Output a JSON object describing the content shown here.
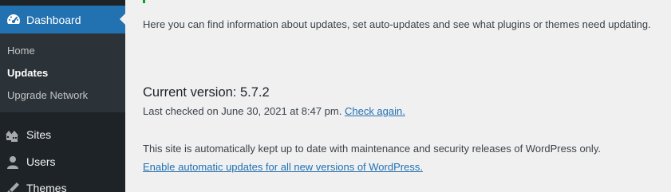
{
  "sidebar": {
    "dashboard": {
      "label": "Dashboard",
      "icon": "dashboard-gauge-icon"
    },
    "submenu": [
      {
        "label": "Home"
      },
      {
        "label": "Updates"
      },
      {
        "label": "Upgrade Network"
      }
    ],
    "items": [
      {
        "label": "Sites",
        "icon": "sites-icon"
      },
      {
        "label": "Users",
        "icon": "users-icon"
      },
      {
        "label": "Themes",
        "icon": "themes-brush-icon"
      }
    ]
  },
  "main": {
    "intro": "Here you can find information about updates, set auto-updates and see what plugins or themes need updating.",
    "current_version": "Current version: 5.7.2",
    "last_checked": "Last checked on June 30, 2021 at 8:47 pm.",
    "check_again": "Check again.",
    "auto_text": "This site is automatically kept up to date with maintenance and security releases of WordPress only.",
    "auto_link": "Enable automatic updates for all new versions of WordPress."
  },
  "colors": {
    "accent": "#2271b1",
    "sidebar_bg": "#1d2327",
    "submenu_bg": "#2c3338",
    "notice_green": "#00a32a"
  }
}
